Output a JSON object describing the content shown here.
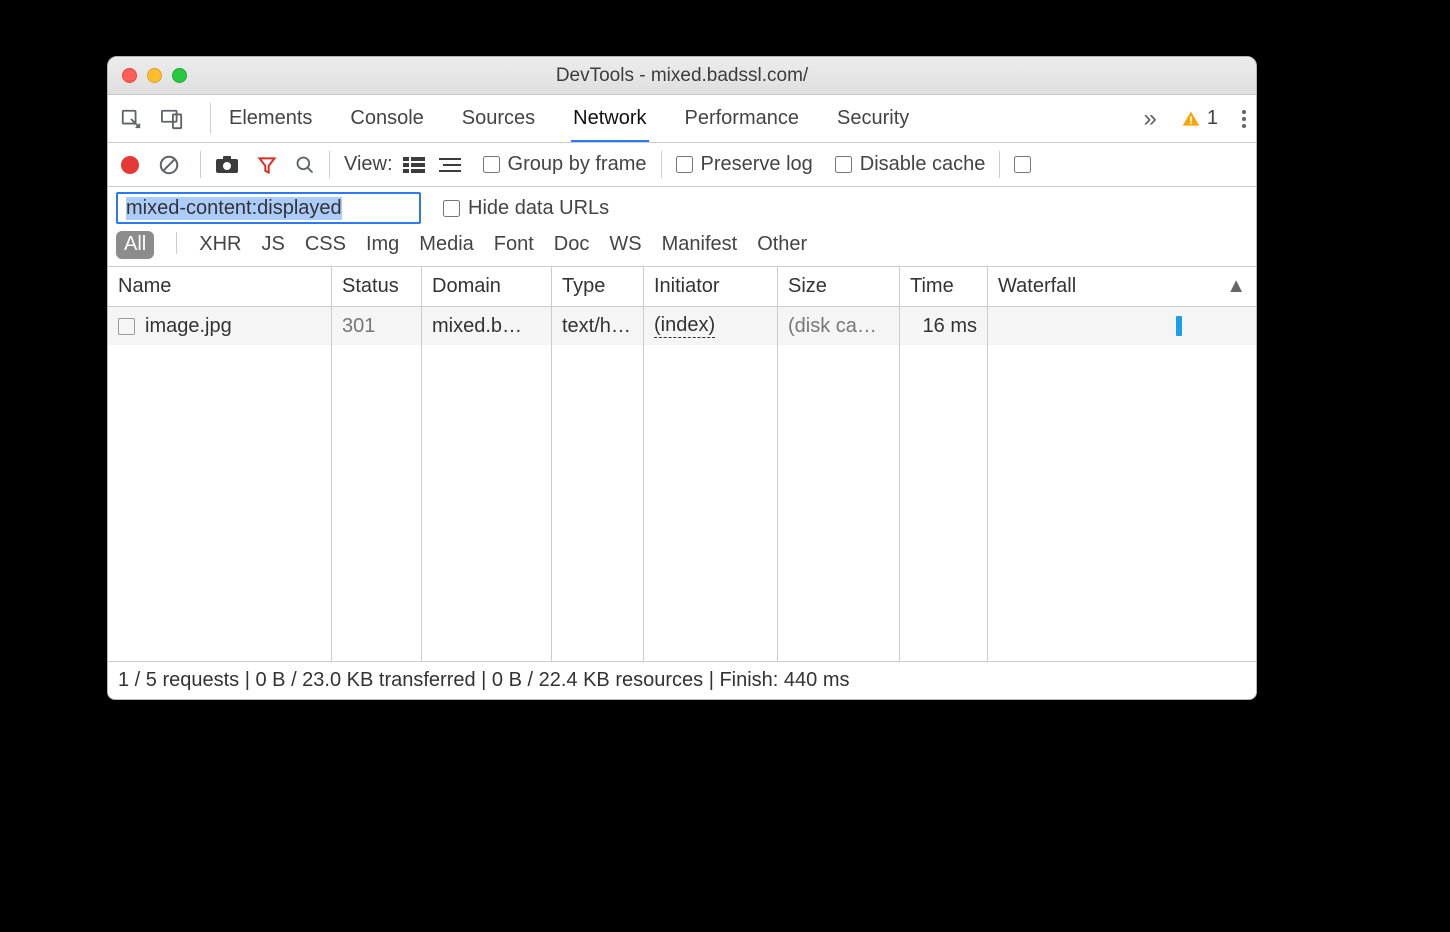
{
  "window": {
    "title": "DevTools - mixed.badssl.com/"
  },
  "tabs": {
    "items": [
      "Elements",
      "Console",
      "Sources",
      "Network",
      "Performance",
      "Security"
    ],
    "active_index": 3,
    "warnings_count": "1"
  },
  "toolbar": {
    "view_label": "View:",
    "group_by_frame": "Group by frame",
    "preserve_log": "Preserve log",
    "disable_cache": "Disable cache"
  },
  "filter": {
    "value": "mixed-content:displayed",
    "hide_data_urls": "Hide data URLs"
  },
  "types": {
    "all": "All",
    "items": [
      "XHR",
      "JS",
      "CSS",
      "Img",
      "Media",
      "Font",
      "Doc",
      "WS",
      "Manifest",
      "Other"
    ]
  },
  "columns": [
    "Name",
    "Status",
    "Domain",
    "Type",
    "Initiator",
    "Size",
    "Time",
    "Waterfall"
  ],
  "rows": [
    {
      "name": "image.jpg",
      "status": "301",
      "domain": "mixed.b…",
      "type": "text/h…",
      "initiator": "(index)",
      "size": "(disk ca…",
      "time": "16 ms"
    }
  ],
  "statusbar": "1 / 5 requests | 0 B / 23.0 KB transferred | 0 B / 22.4 KB resources | Finish: 440 ms"
}
